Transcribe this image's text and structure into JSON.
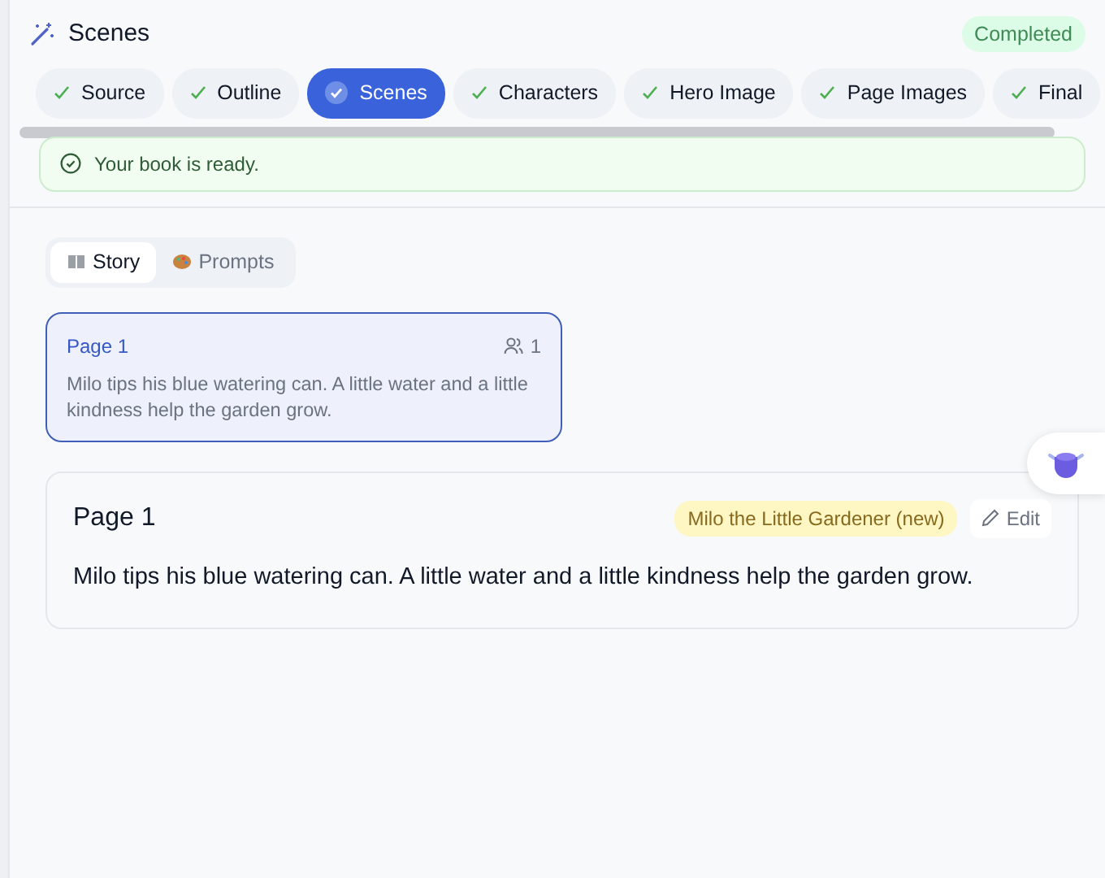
{
  "header": {
    "title": "Scenes",
    "status": "Completed"
  },
  "steps": [
    {
      "label": "Source",
      "done": true,
      "selected": false
    },
    {
      "label": "Outline",
      "done": true,
      "selected": false
    },
    {
      "label": "Scenes",
      "done": true,
      "selected": true
    },
    {
      "label": "Characters",
      "done": true,
      "selected": false
    },
    {
      "label": "Hero Image",
      "done": true,
      "selected": false
    },
    {
      "label": "Page Images",
      "done": true,
      "selected": false
    },
    {
      "label": "Final",
      "done": true,
      "selected": false
    }
  ],
  "alert": {
    "text": "Your book is ready."
  },
  "view_tabs": [
    {
      "label": "Story",
      "kind": "book",
      "selected": true
    },
    {
      "label": "Prompts",
      "kind": "palette",
      "selected": false
    }
  ],
  "page_list": [
    {
      "title": "Page 1",
      "characters": "1",
      "text": "Milo tips his blue watering can. A little water and a little kindness help the garden grow.",
      "selected": true
    }
  ],
  "detail": {
    "title": "Page 1",
    "tag": "Milo the Little Gardener (new)",
    "edit": "Edit",
    "text": "Milo tips his blue watering can. A little water and a little kindness help the garden grow."
  }
}
